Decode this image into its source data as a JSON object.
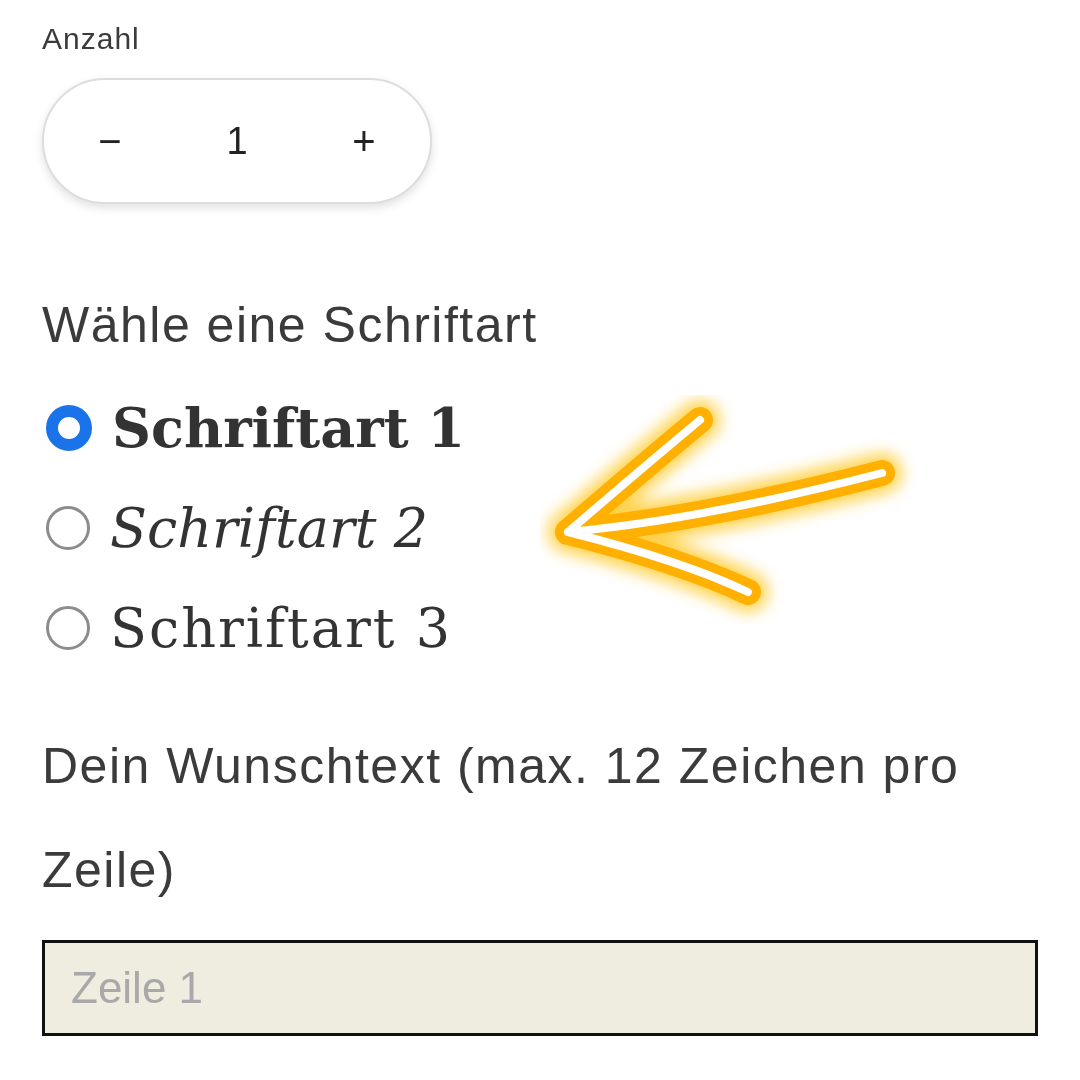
{
  "quantity": {
    "label": "Anzahl",
    "minus": "−",
    "value": "1",
    "plus": "+"
  },
  "font_choice": {
    "heading": "Wähle eine Schriftart",
    "options": [
      {
        "label": "Schriftart 1",
        "kind": "bold",
        "selected": true
      },
      {
        "label": "Schriftart 2",
        "kind": "script",
        "selected": false
      },
      {
        "label": "Schriftart 3",
        "kind": "plain",
        "selected": false
      }
    ]
  },
  "wish_text": {
    "label": "Dein Wunschtext (max. 12 Zeichen pro Zeile)",
    "field": {
      "placeholder": "Zeile 1"
    }
  }
}
